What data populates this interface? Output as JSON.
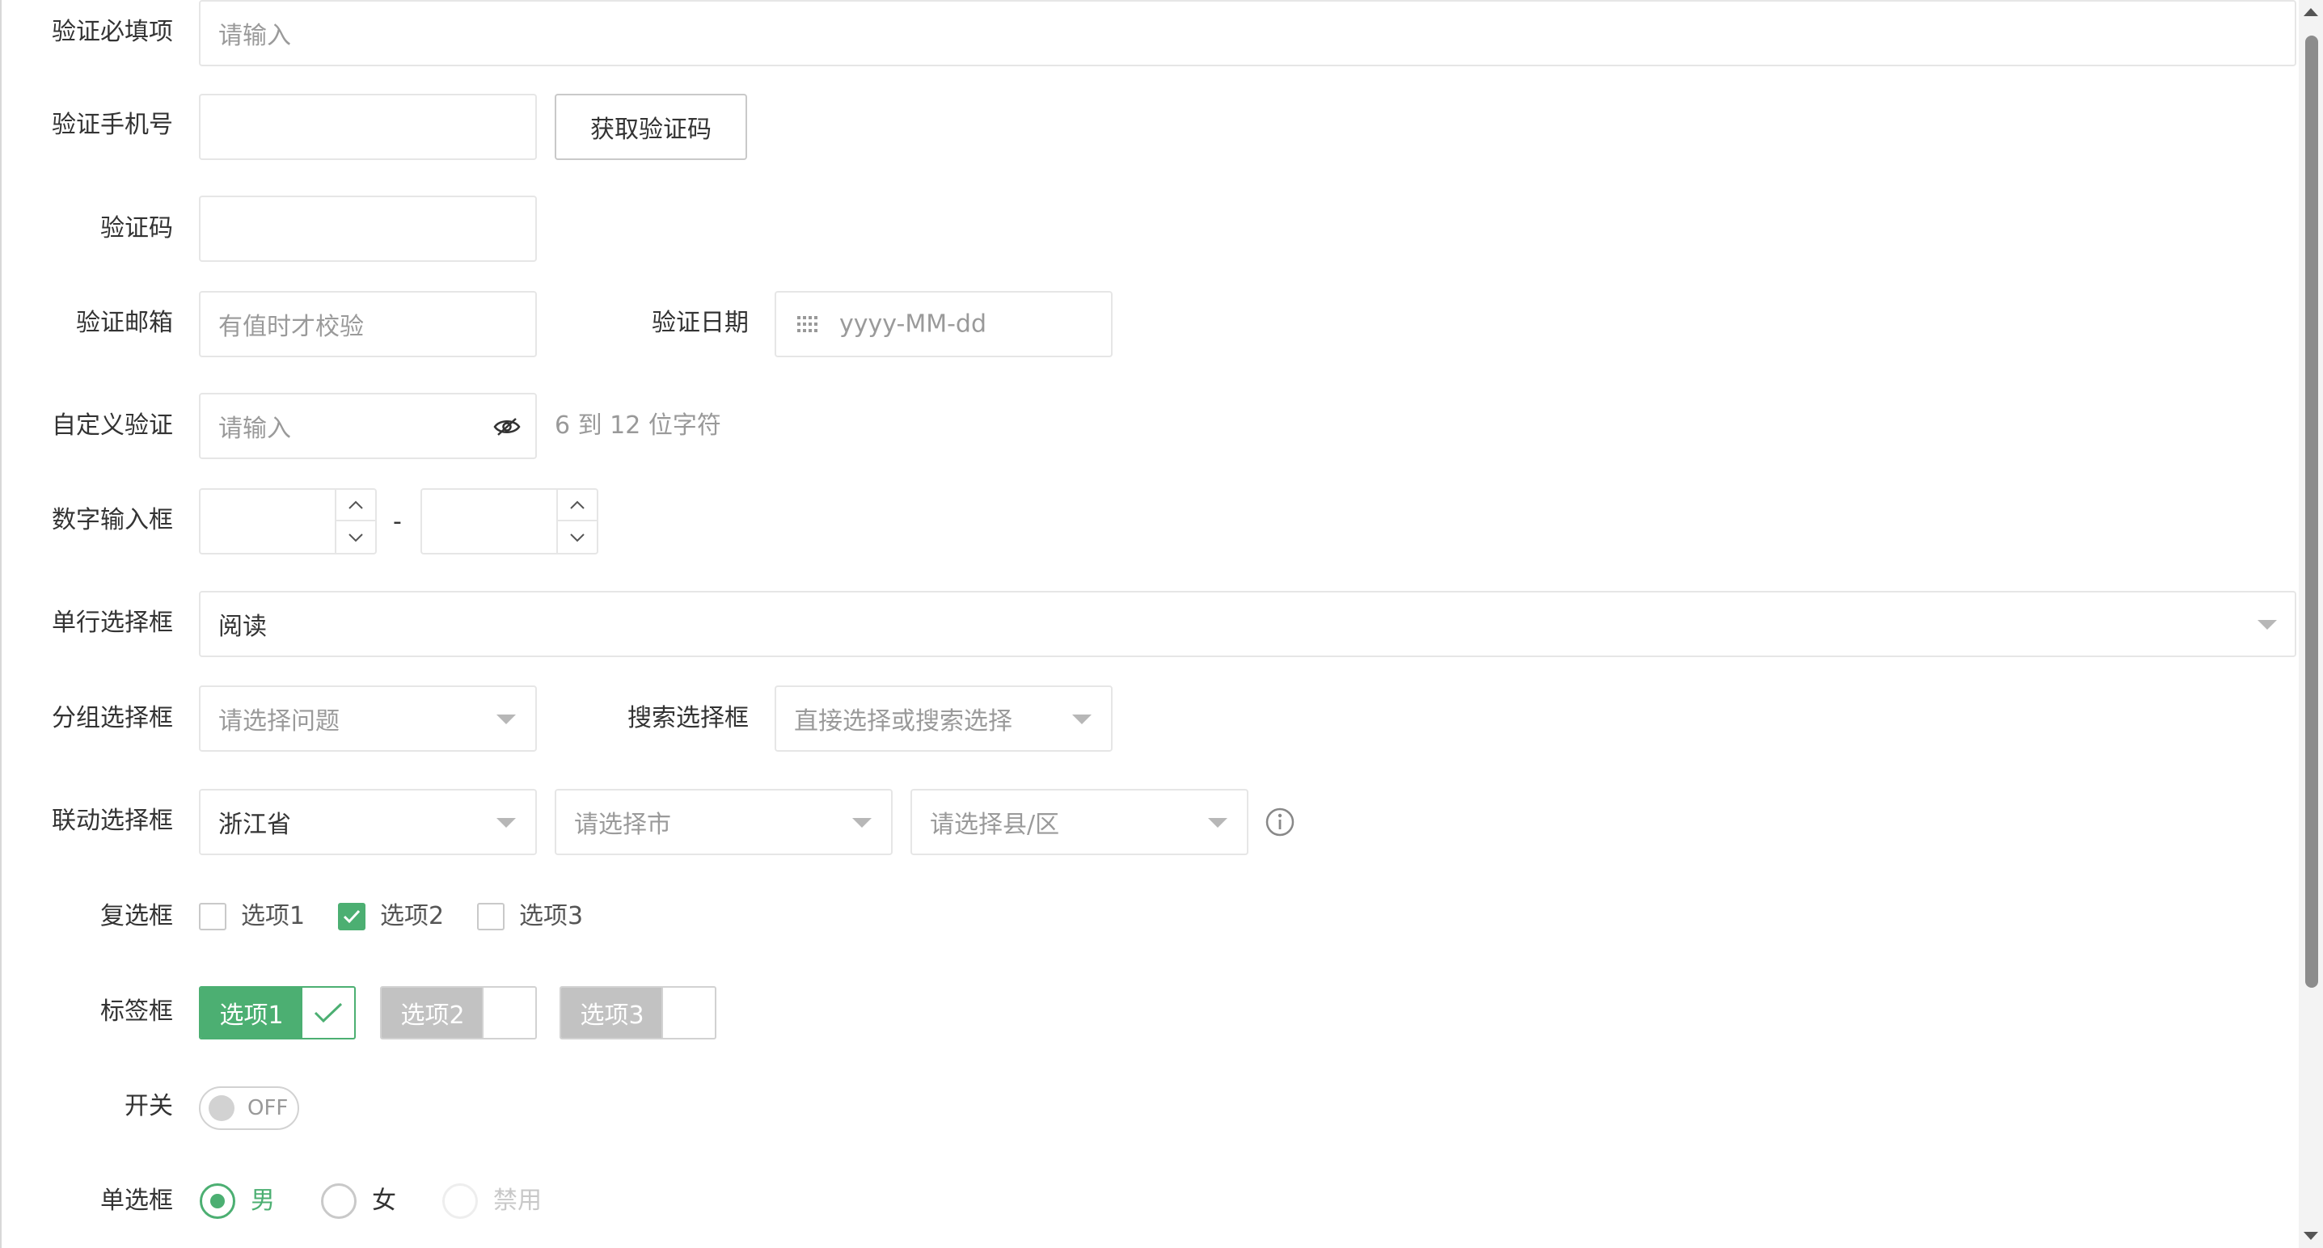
{
  "form": {
    "required": {
      "label": "验证必填项",
      "placeholder": "请输入"
    },
    "phone": {
      "label": "验证手机号",
      "value": "",
      "button": "获取验证码"
    },
    "code": {
      "label": "验证码",
      "value": ""
    },
    "email": {
      "label": "验证邮箱",
      "placeholder": "有值时才校验"
    },
    "date": {
      "label": "验证日期",
      "placeholder": "yyyy-MM-dd"
    },
    "custom": {
      "label": "自定义验证",
      "placeholder": "请输入",
      "hint": "6 到 12 位字符"
    },
    "number": {
      "label": "数字输入框",
      "separator": "-"
    },
    "single_select": {
      "label": "单行选择框",
      "value": "阅读"
    },
    "group_select": {
      "label": "分组选择框",
      "placeholder": "请选择问题"
    },
    "search_select": {
      "label": "搜索选择框",
      "placeholder": "直接选择或搜索选择"
    },
    "linked_select": {
      "label": "联动选择框",
      "province": "浙江省",
      "city_placeholder": "请选择市",
      "county_placeholder": "请选择县/区"
    },
    "checkbox": {
      "label": "复选框",
      "options": [
        {
          "label": "选项1",
          "checked": false
        },
        {
          "label": "选项2",
          "checked": true
        },
        {
          "label": "选项3",
          "checked": false
        }
      ]
    },
    "tag_checkbox": {
      "label": "标签框",
      "options": [
        {
          "label": "选项1",
          "checked": true
        },
        {
          "label": "选项2",
          "checked": false
        },
        {
          "label": "选项3",
          "checked": false
        }
      ]
    },
    "switch": {
      "label": "开关",
      "state_text": "OFF"
    },
    "radio": {
      "label": "单选框",
      "options": [
        {
          "label": "男",
          "checked": true,
          "disabled": false
        },
        {
          "label": "女",
          "checked": false,
          "disabled": false
        },
        {
          "label": "禁用",
          "checked": false,
          "disabled": true
        }
      ]
    }
  },
  "colors": {
    "accent": "#4caf72",
    "tag_inactive": "#c2c2c2",
    "border": "#e6e6e6",
    "placeholder": "#9a9a9a"
  },
  "icons": {
    "date": "calendar-icon",
    "password": "eye-icon",
    "info": "info-icon"
  }
}
